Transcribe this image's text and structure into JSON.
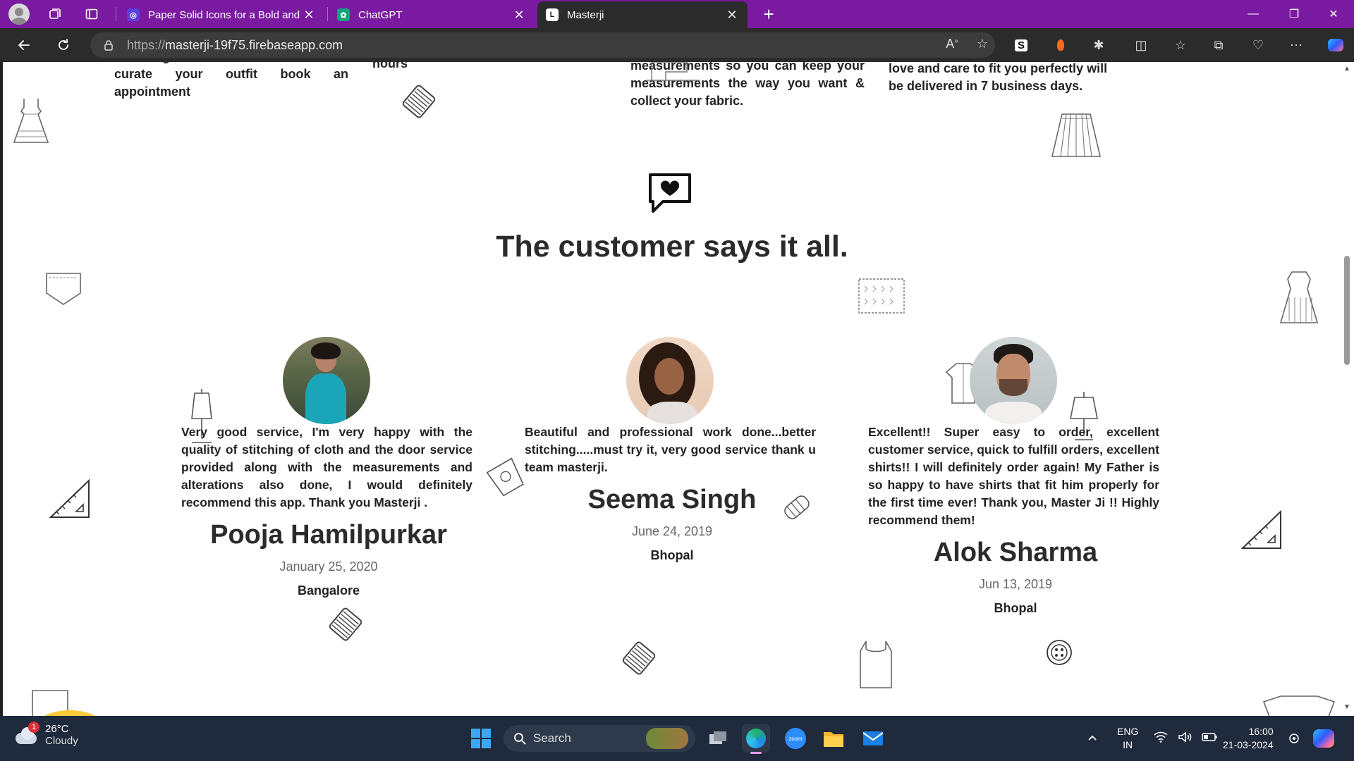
{
  "browser": {
    "tabs": [
      {
        "title": "Paper Solid Icons for a Bold and",
        "close": "✕"
      },
      {
        "title": "ChatGPT",
        "close": "✕"
      },
      {
        "title": "Masterji",
        "close": "✕"
      }
    ],
    "url_protocol": "https://",
    "url_host": "masterji-19f75.firebaseapp.com",
    "new_tab": "+",
    "window_controls": [
      "—",
      "❐",
      "✕"
    ]
  },
  "page": {
    "steps": [
      {
        "text": "subcategories in Men and Women and curate your outfit book an appointment"
      },
      {
        "text": "hours"
      },
      {
        "text": "measurements so you can keep your measurements the way you want & collect your fabric."
      },
      {
        "text": "love and care to fit you perfectly will be delivered in 7 business days."
      }
    ],
    "testimonials_title": "The customer says it all.",
    "reviews": [
      {
        "text": "Very good service, I'm very happy with the quality of stitching of cloth and the door service provided along with the measurements and alterations also done, I would definitely recommend this app. Thank you Masterji .",
        "name": "Pooja Hamilpurkar",
        "date": "January 25, 2020",
        "city": "Bangalore"
      },
      {
        "text": "Beautiful and professional work done...better stitching.....must try it, very good service thank u team masterji.",
        "name": "Seema Singh",
        "date": "June 24, 2019",
        "city": "Bhopal"
      },
      {
        "text": "Excellent!! Super easy to order, excellent customer service, quick to fulfill orders, excellent shirts!! I will definitely order again! My Father is so happy to have shirts that fit him properly for the first time ever! Thank you, Master Ji !! Highly recommend them!",
        "name": "Alok Sharma",
        "date": "Jun 13, 2019",
        "city": "Bhopal"
      }
    ]
  },
  "taskbar": {
    "weather_temp": "26°C",
    "weather_cond": "Cloudy",
    "weather_badge": "1",
    "search_label": "Search",
    "lang_top": "ENG",
    "lang_bottom": "IN",
    "time": "16:00",
    "date": "21-03-2024"
  },
  "colors": {
    "tabbar": "#7a1aa0",
    "toolbar": "#2b2b2b",
    "taskbar": "#1f2a3c"
  }
}
